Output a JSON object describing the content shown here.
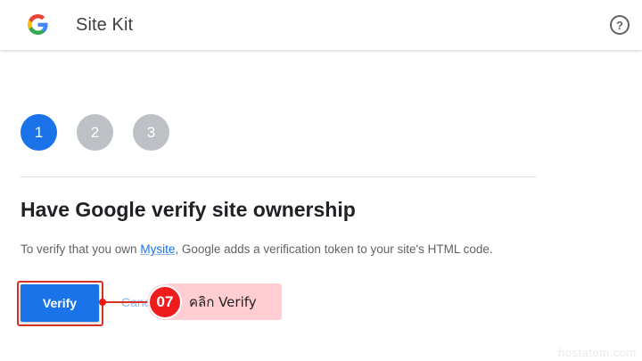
{
  "header": {
    "app_title": "Site Kit",
    "logo_icon": "google-g-icon",
    "help_icon": "help-icon",
    "help_glyph": "?"
  },
  "stepper": {
    "steps": [
      {
        "label": "1",
        "state": "active"
      },
      {
        "label": "2",
        "state": "inactive"
      },
      {
        "label": "3",
        "state": "inactive"
      }
    ]
  },
  "content": {
    "heading": "Have Google verify site ownership",
    "description_before": "To verify that you own ",
    "site_name": "Mysite",
    "description_after": ", Google adds a verification token to your site's HTML code.",
    "verify_label": "Verify",
    "cancel_label": "Cancel"
  },
  "annotation": {
    "step_number": "07",
    "label": "คลิก Verify"
  },
  "watermark": "hostatom.com",
  "colors": {
    "primary": "#1a73e8",
    "step_inactive": "#bdc1c6",
    "annotation_red": "#ee1c1c",
    "annotation_bg": "#ffcdd2"
  }
}
